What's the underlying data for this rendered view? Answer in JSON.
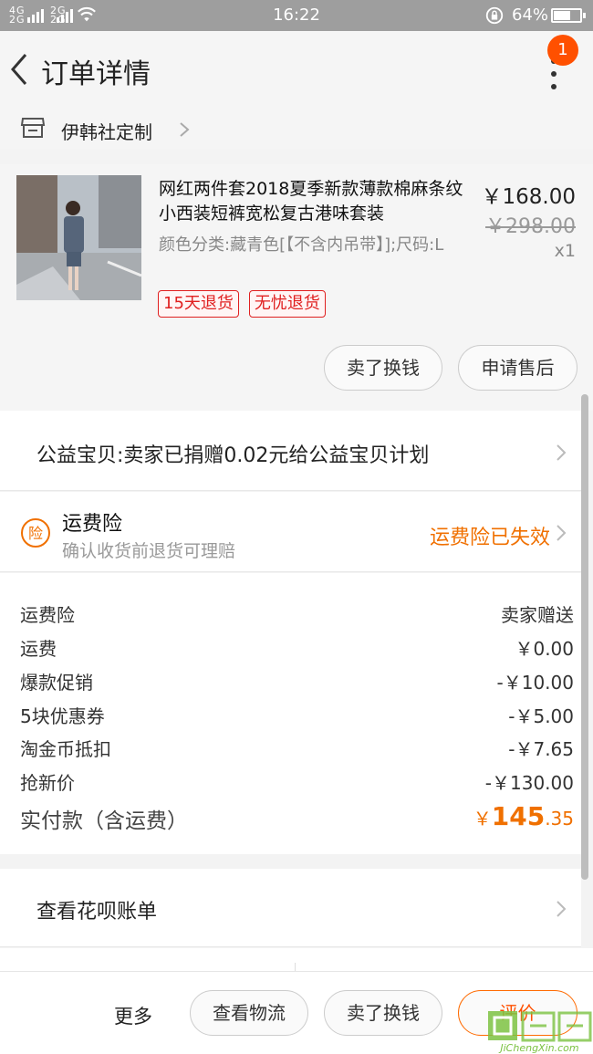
{
  "status_bar": {
    "network_top": "4G",
    "network_top2": "2G",
    "network_bottom": "2G",
    "network_bottom2": "2G",
    "time": "16:22",
    "battery_percent": "64%",
    "battery_level": 0.64
  },
  "header": {
    "title": "订单详情",
    "notification_count": "1"
  },
  "shop": {
    "name": "伊韩社定制"
  },
  "product": {
    "title": "网红两件套2018夏季新款薄款棉麻条纹小西装短裤宽松复古港味套装",
    "sku": "颜色分类:藏青色[【不含内吊带】];尺码:L",
    "price": "￥168.00",
    "original_price": "￥298.00",
    "quantity": "x1",
    "tags": [
      "15天退货",
      "无忧退货"
    ]
  },
  "item_actions": {
    "sell_label": "卖了换钱",
    "after_sale_label": "申请售后"
  },
  "charity": {
    "text": "公益宝贝:卖家已捐赠0.02元给公益宝贝计划"
  },
  "insurance": {
    "icon_char": "险",
    "name": "运费险",
    "description": "确认收货前退货可理赔",
    "status": "运费险已失效"
  },
  "fees": [
    {
      "label": "运费险",
      "value": "卖家赠送"
    },
    {
      "label": "运费",
      "value": "￥0.00"
    },
    {
      "label": "爆款促销",
      "value": "-￥10.00"
    },
    {
      "label": "5块优惠券",
      "value": "-￥5.00"
    },
    {
      "label": "淘金币抵扣",
      "value": "-￥7.65"
    },
    {
      "label": "抢新价",
      "value": "-￥130.00"
    }
  ],
  "total": {
    "label": "实付款（含运费）",
    "currency": "￥",
    "integer": "145",
    "decimal": ".35"
  },
  "bill": {
    "text": "查看花呗账单"
  },
  "bottom_bar": {
    "more_label": "更多",
    "logistics_label": "查看物流",
    "sell_label": "卖了换钱",
    "rate_label": "评价"
  },
  "watermark": {
    "url": "JiChengXin.com"
  },
  "colors": {
    "accent_orange": "#ff5000",
    "status_orange": "#f07000",
    "tag_red": "#e02020",
    "watermark_green": "#7cc242"
  }
}
